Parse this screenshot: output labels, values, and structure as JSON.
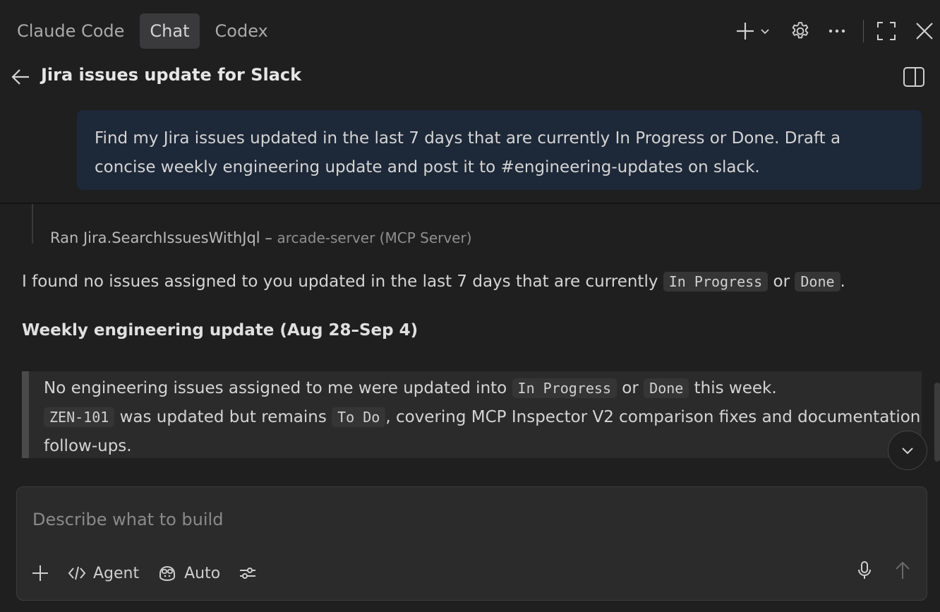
{
  "tabs": [
    {
      "label": "Claude Code",
      "active": false
    },
    {
      "label": "Chat",
      "active": true
    },
    {
      "label": "Codex",
      "active": false
    }
  ],
  "icons": {
    "new": "plus-icon",
    "new_menu": "chevron-down-icon",
    "settings": "gear-icon",
    "more": "ellipsis-icon",
    "maximize": "maximize-icon",
    "close": "close-icon",
    "back": "arrow-left-icon",
    "panel": "panel-toggle-icon"
  },
  "conversation": {
    "title": "Jira issues update for Slack"
  },
  "user_message": {
    "text": "Find my Jira issues updated in the last 7 days that are currently In Progress or Done. Draft a concise weekly engineering update and post it to #engineering-updates on slack."
  },
  "tool_call": {
    "label": "Ran Jira.SearchIssuesWithJql",
    "separator": "–",
    "server": "arcade-server (MCP Server)"
  },
  "response": {
    "p1_before": "I found no issues assigned to you updated in the last 7 days that are currently ",
    "code_in_progress": "In Progress",
    "p1_or": " or ",
    "code_done": "Done",
    "p1_end": ".",
    "heading": "Weekly engineering update (Aug 28–Sep 4)",
    "quote": {
      "t1": "No engineering issues assigned to me were updated into ",
      "c1": "In Progress",
      "t2": " or ",
      "c2": "Done",
      "t3": " this week.",
      "c3": "ZEN-101",
      "t4": " was updated but remains ",
      "c4": "To Do",
      "t5": ", covering MCP Inspector V2 comparison fixes and documentation follow-ups."
    }
  },
  "composer": {
    "placeholder": "Describe what to build",
    "value": "",
    "mode_label": "Agent",
    "model_label": "Auto"
  },
  "colors": {
    "background": "#1f1f1f",
    "user_bubble": "#1d2838",
    "code_bg": "#353535",
    "quote_bg": "#2b2b2b"
  }
}
